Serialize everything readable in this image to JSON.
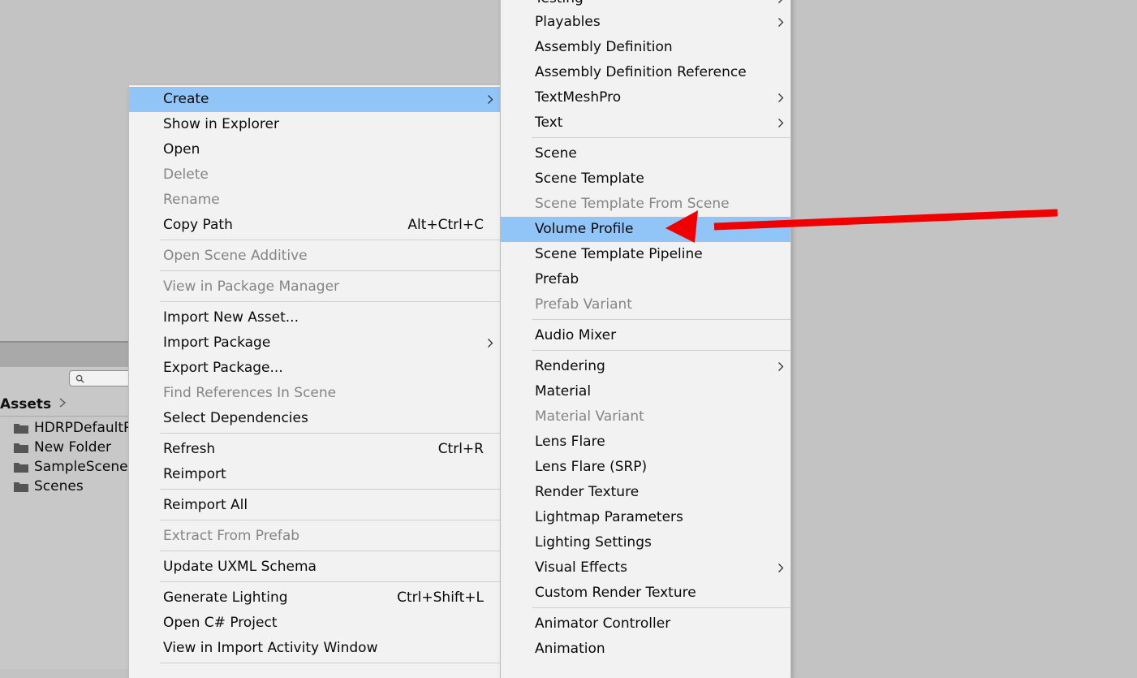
{
  "project": {
    "assets_label": "Assets",
    "folders": [
      "HDRPDefaultResources",
      "New Folder",
      "SampleScenes",
      "Scenes"
    ]
  },
  "context_menu": {
    "items": [
      {
        "label": "Create",
        "submenu": true,
        "selected": true
      },
      {
        "label": "Show in Explorer"
      },
      {
        "label": "Open"
      },
      {
        "label": "Delete",
        "disabled": true
      },
      {
        "label": "Rename",
        "disabled": true
      },
      {
        "label": "Copy Path",
        "shortcut": "Alt+Ctrl+C"
      },
      {
        "label": "Open Scene Additive",
        "disabled": true
      },
      {
        "label": "View in Package Manager",
        "disabled": true
      },
      {
        "label": "Import New Asset..."
      },
      {
        "label": "Import Package",
        "submenu": true
      },
      {
        "label": "Export Package..."
      },
      {
        "label": "Find References In Scene",
        "disabled": true
      },
      {
        "label": "Select Dependencies"
      },
      {
        "label": "Refresh",
        "shortcut": "Ctrl+R"
      },
      {
        "label": "Reimport"
      },
      {
        "label": "Reimport All"
      },
      {
        "label": "Extract From Prefab",
        "disabled": true
      },
      {
        "label": "Update UXML Schema"
      },
      {
        "label": "Generate Lighting",
        "shortcut": "Ctrl+Shift+L"
      },
      {
        "label": "Open C# Project"
      },
      {
        "label": "View in Import Activity Window"
      }
    ]
  },
  "create_submenu": {
    "items": [
      {
        "label": "Testing",
        "submenu": true
      },
      {
        "label": "Playables",
        "submenu": true
      },
      {
        "label": "Assembly Definition"
      },
      {
        "label": "Assembly Definition Reference"
      },
      {
        "label": "TextMeshPro",
        "submenu": true
      },
      {
        "label": "Text",
        "submenu": true
      },
      {
        "label": "Scene"
      },
      {
        "label": "Scene Template"
      },
      {
        "label": "Scene Template From Scene",
        "disabled": true
      },
      {
        "label": "Volume Profile",
        "selected": true
      },
      {
        "label": "Scene Template Pipeline"
      },
      {
        "label": "Prefab"
      },
      {
        "label": "Prefab Variant",
        "disabled": true
      },
      {
        "label": "Audio Mixer"
      },
      {
        "label": "Rendering",
        "submenu": true
      },
      {
        "label": "Material"
      },
      {
        "label": "Material Variant",
        "disabled": true
      },
      {
        "label": "Lens Flare"
      },
      {
        "label": "Lens Flare (SRP)"
      },
      {
        "label": "Render Texture"
      },
      {
        "label": "Lightmap Parameters"
      },
      {
        "label": "Lighting Settings"
      },
      {
        "label": "Visual Effects",
        "submenu": true
      },
      {
        "label": "Custom Render Texture"
      },
      {
        "label": "Animator Controller"
      },
      {
        "label": "Animation"
      }
    ]
  },
  "colors": {
    "menu_bg": "#f2f2f2",
    "selection": "#91c5f7",
    "disabled_text": "#858585",
    "annotation_arrow": "#f00000"
  }
}
